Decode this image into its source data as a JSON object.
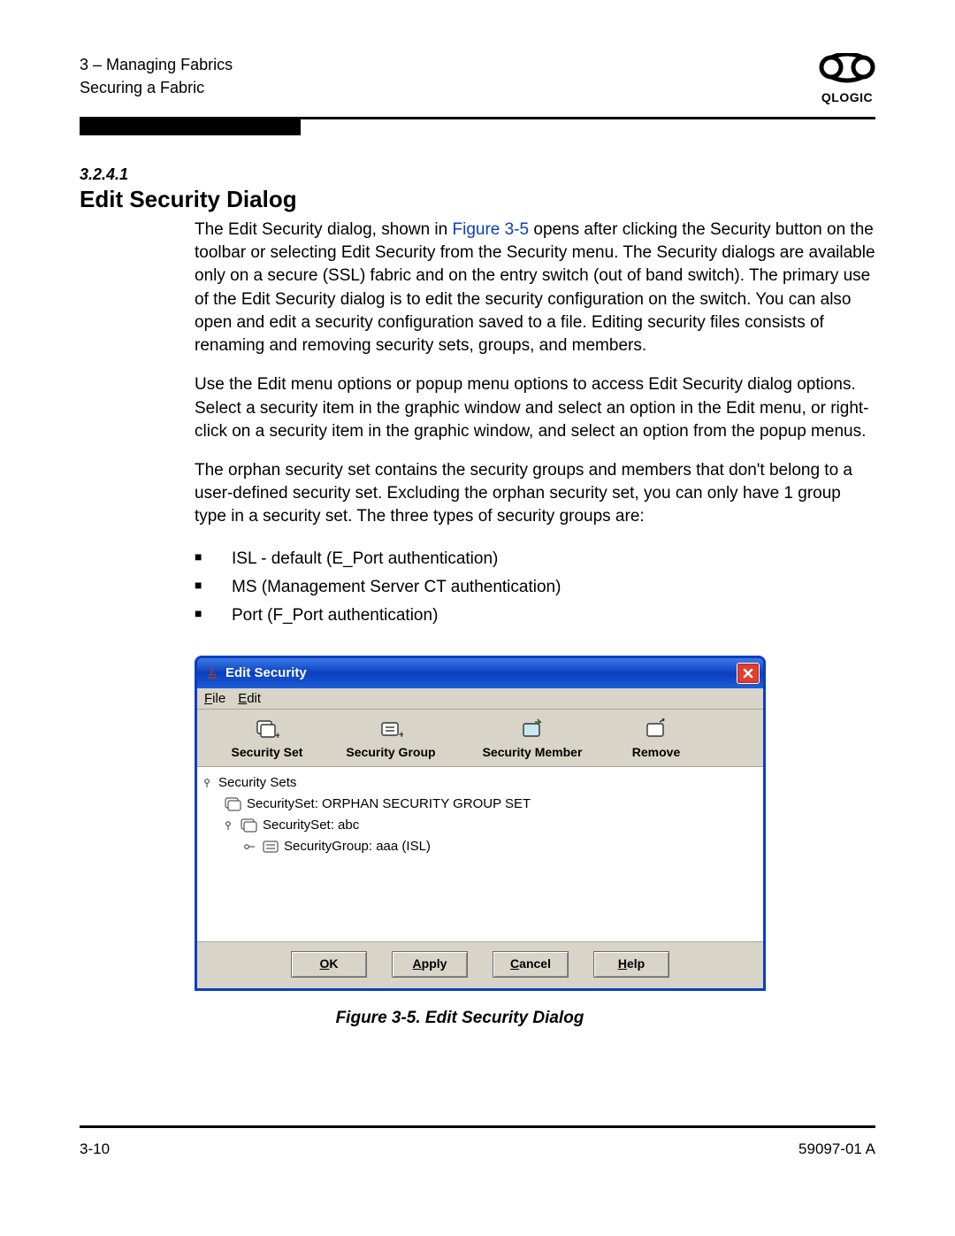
{
  "header": {
    "chapter_line": "3 – Managing Fabrics",
    "section_line": "Securing a Fabric",
    "brand": "QLOGIC"
  },
  "section": {
    "number": "3.2.4.1",
    "title": "Edit Security Dialog"
  },
  "paragraphs": {
    "p1_a": "The Edit Security dialog, shown in ",
    "p1_link": "Figure 3-5",
    "p1_b": " opens after clicking the Security button on the toolbar or selecting Edit Security from the Security menu. The Security dialogs are available only on a secure (SSL) fabric and on the entry switch (out of band switch). The primary use of the Edit Security dialog is to edit the security configuration on the switch. You can also open and edit a security configuration saved to a file. Editing security files consists of renaming and removing security sets, groups, and members.",
    "p2": "Use the Edit menu options or popup menu options to access Edit Security dialog options. Select a security item in the graphic window and select an option in the Edit menu, or right-click on a security item in the graphic window, and select an option from the popup menus.",
    "p3": "The orphan security set contains the security groups and members that don't belong to a user-defined security set. Excluding the orphan security set, you can only have 1 group type in a security set. The three types of security groups are:"
  },
  "bullets": [
    "ISL - default (E_Port authentication)",
    "MS (Management Server CT authentication)",
    "Port (F_Port authentication)"
  ],
  "dialog": {
    "title": "Edit Security",
    "menu": {
      "file": "File",
      "edit": "Edit"
    },
    "toolbar": {
      "set": "Security Set",
      "group": "Security Group",
      "member": "Security Member",
      "remove": "Remove"
    },
    "tree": {
      "root": "Security Sets",
      "item1": "SecuritySet: ORPHAN SECURITY GROUP SET",
      "item2": "SecuritySet: abc",
      "item3": "SecurityGroup: aaa (ISL)"
    },
    "buttons": {
      "ok": "OK",
      "apply": "Apply",
      "cancel": "Cancel",
      "help": "Help"
    }
  },
  "figure_caption": "Figure 3-5.  Edit Security Dialog",
  "footer": {
    "page": "3-10",
    "docnum": "59097-01 A"
  }
}
